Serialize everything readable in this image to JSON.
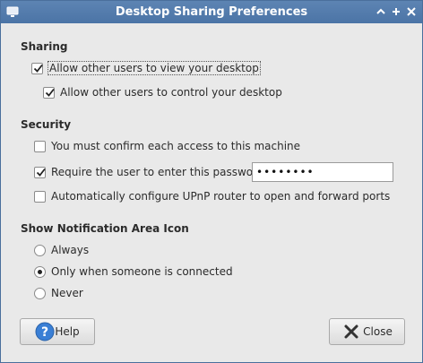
{
  "window": {
    "title": "Desktop Sharing Preferences"
  },
  "sharing": {
    "heading": "Sharing",
    "view_desktop": {
      "label": "Allow other users to view your desktop",
      "checked": true
    },
    "control_desktop": {
      "label": "Allow other users to control your desktop",
      "checked": true
    }
  },
  "security": {
    "heading": "Security",
    "confirm_access": {
      "label": "You must confirm each access to this machine",
      "checked": false
    },
    "require_password": {
      "label": "Require the user to enter this password:",
      "checked": true
    },
    "password_value": "••••••••",
    "upnp": {
      "label": "Automatically configure UPnP router to open and forward ports",
      "checked": false
    }
  },
  "notification": {
    "heading": "Show Notification Area Icon",
    "options": [
      {
        "label": "Always",
        "selected": false
      },
      {
        "label": "Only when someone is connected",
        "selected": true
      },
      {
        "label": "Never",
        "selected": false
      }
    ]
  },
  "buttons": {
    "help_label": "Help",
    "close_label": "Close"
  },
  "colors": {
    "titlebar": "#5d84b3",
    "window_bg": "#e9e9e9",
    "help_icon": "#3a7fd5",
    "close_icon": "#333333"
  }
}
